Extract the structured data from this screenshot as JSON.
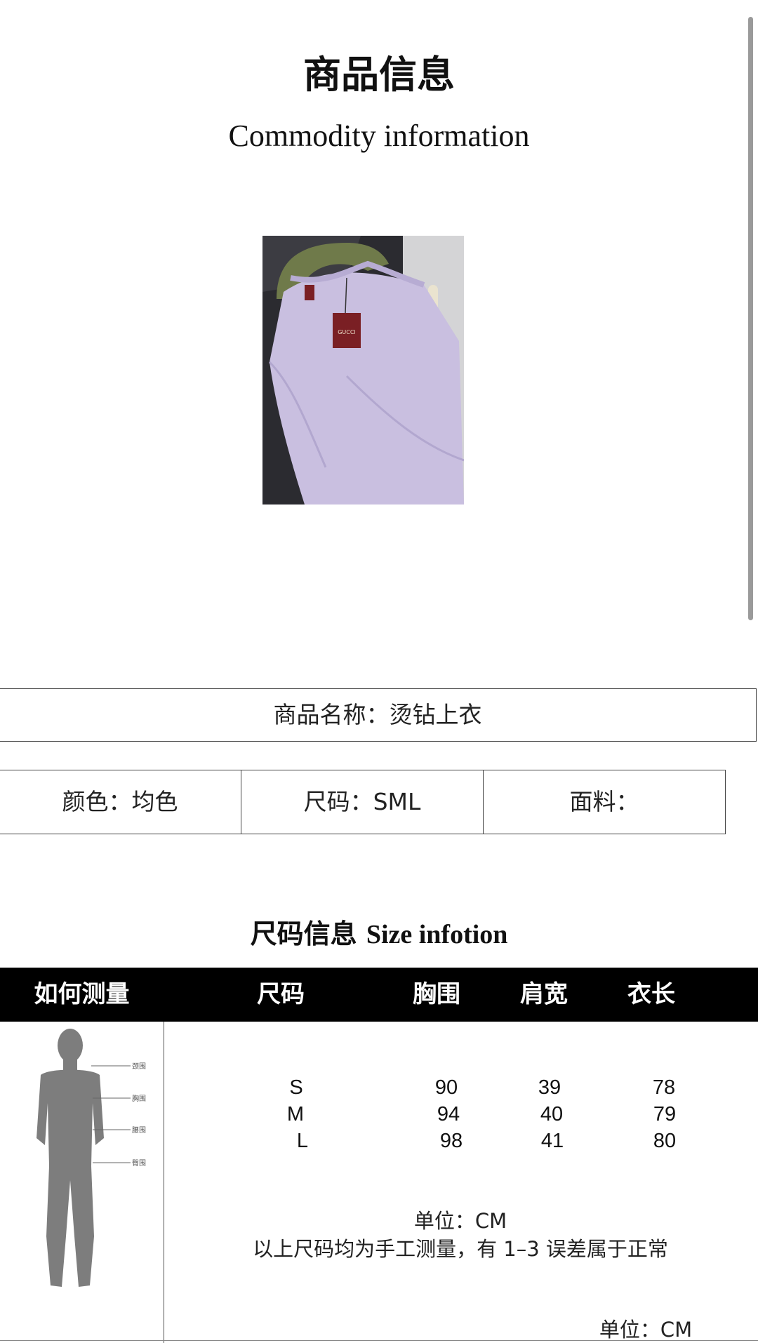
{
  "header": {
    "title_cn": "商品信息",
    "title_en": "Commodity information"
  },
  "product": {
    "name": "商品名称：烫钻上衣",
    "color": "颜色：均色",
    "size": "尺码：SML",
    "fabric": "面料："
  },
  "size_section": {
    "title_cn": "尺码信息",
    "title_en": "Size infotion"
  },
  "size_table": {
    "headers": [
      "如何测量",
      "尺码",
      "胸围",
      "肩宽",
      "衣长"
    ],
    "rows": [
      {
        "size": "S",
        "chest": "90",
        "shoulder": "39",
        "length": "78"
      },
      {
        "size": "M",
        "chest": "94",
        "shoulder": "40",
        "length": "79"
      },
      {
        "size": "L",
        "chest": "98",
        "shoulder": "41",
        "length": "80"
      }
    ],
    "figure_labels": [
      "颈围",
      "胸围",
      "腰围",
      "臀围"
    ],
    "unit_note": "单位：CM",
    "error_note": "以上尺码均为手工测量，有 1–3 误差属于正常",
    "unit_bottom": "单位：CM"
  },
  "photo": {
    "tag_text": "GUCCI",
    "colors": {
      "garment": "#c9bfe0",
      "tag": "#7a1f24",
      "hanger": "#6f7a4a"
    }
  }
}
